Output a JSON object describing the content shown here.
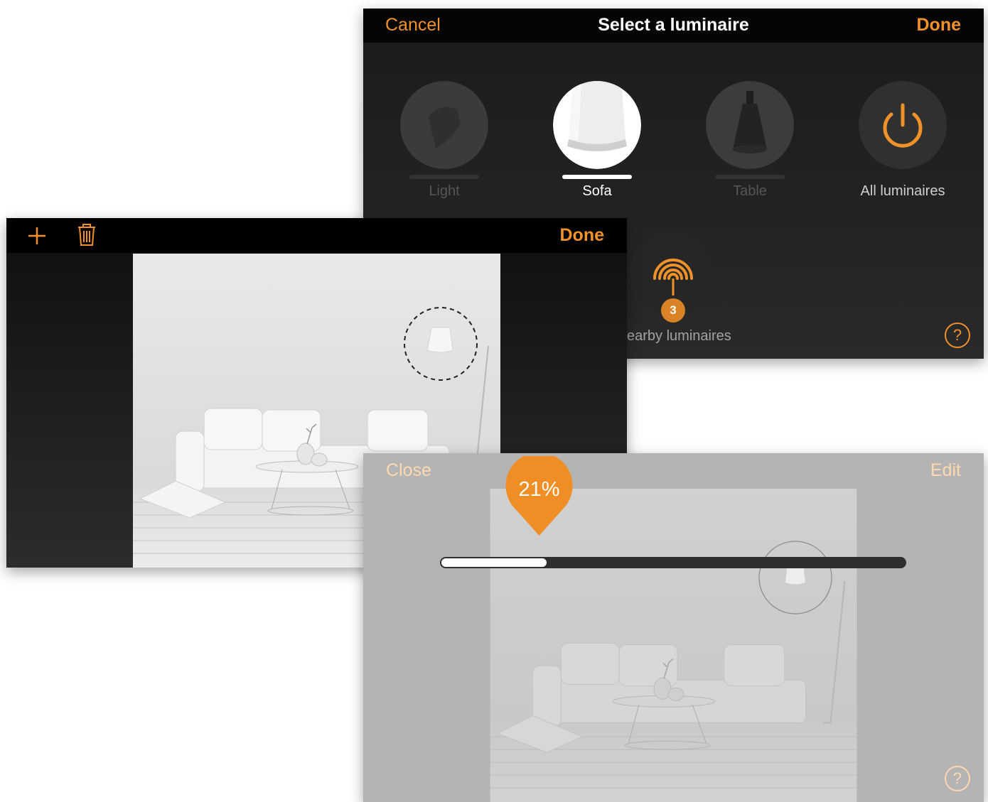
{
  "colors": {
    "accent": "#f0922a",
    "nav_bar": "#050505",
    "faded_accent": "#ffd9ae"
  },
  "selector": {
    "cancel_label": "Cancel",
    "title": "Select a luminaire",
    "done_label": "Done",
    "luminaires": [
      {
        "label": "Light",
        "selected": false,
        "enabled": false
      },
      {
        "label": "Sofa",
        "selected": true,
        "enabled": true
      },
      {
        "label": "Table",
        "selected": false,
        "enabled": false
      },
      {
        "label": "All luminaires",
        "selected": false,
        "enabled": true,
        "icon": "power-icon"
      }
    ],
    "nearby": {
      "label": "earby luminaires",
      "badge": "3",
      "icon": "signal-waves-icon"
    },
    "help_label": "?"
  },
  "editor": {
    "add_icon": "plus-icon",
    "delete_icon": "trash-icon",
    "done_label": "Done"
  },
  "dimmer": {
    "close_label": "Close",
    "edit_label": "Edit",
    "brightness_percent": 21,
    "brightness_label": "21%",
    "help_label": "?"
  }
}
